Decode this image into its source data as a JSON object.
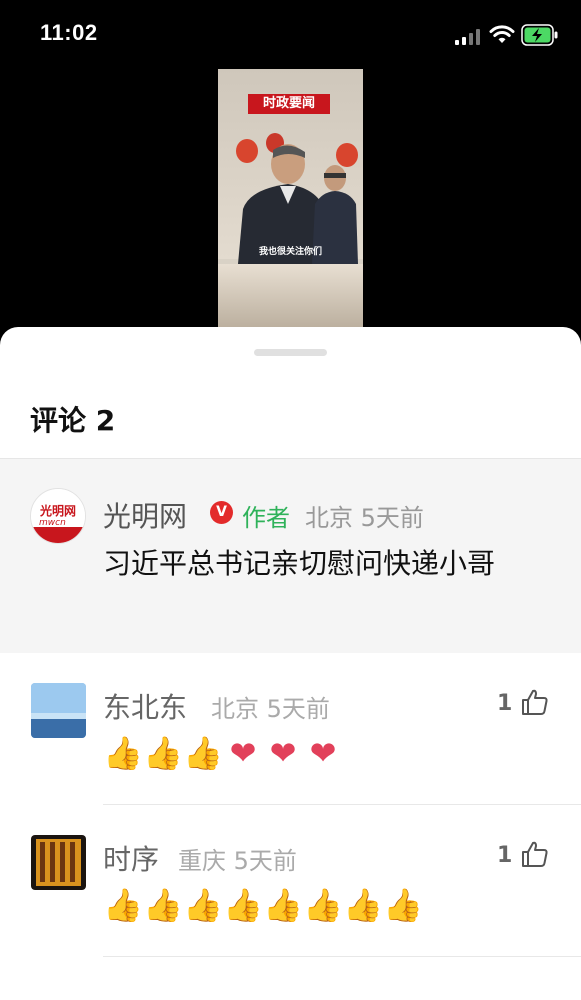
{
  "status_bar": {
    "time": "11:02"
  },
  "video": {
    "banner": "时政要闻",
    "caption": "我也很关注你们"
  },
  "comments_panel": {
    "title": "评论 2",
    "author_comment": {
      "name": "光明网",
      "verified_mark": "V",
      "author_tag": "作者",
      "location_time": "北京 5天前",
      "text": "习近平总书记亲切慰问快递小哥",
      "avatar_text": "光明网"
    },
    "comments": [
      {
        "name": "东北东",
        "location_time": "北京 5天前",
        "likes": "1",
        "emojis": [
          "thumbs-up",
          "thumbs-up",
          "thumbs-up",
          "heart",
          "heart",
          "heart"
        ]
      },
      {
        "name": "时序",
        "location_time": "重庆 5天前",
        "likes": "1",
        "emojis": [
          "thumbs-up",
          "thumbs-up",
          "thumbs-up",
          "thumbs-up",
          "thumbs-up",
          "thumbs-up",
          "thumbs-up",
          "thumbs-up"
        ]
      }
    ]
  },
  "colors": {
    "author_tag": "#2fb25a",
    "verified_badge": "#e32b2b",
    "meta_text": "#999999",
    "highlight_bg": "#f5f5f5"
  }
}
